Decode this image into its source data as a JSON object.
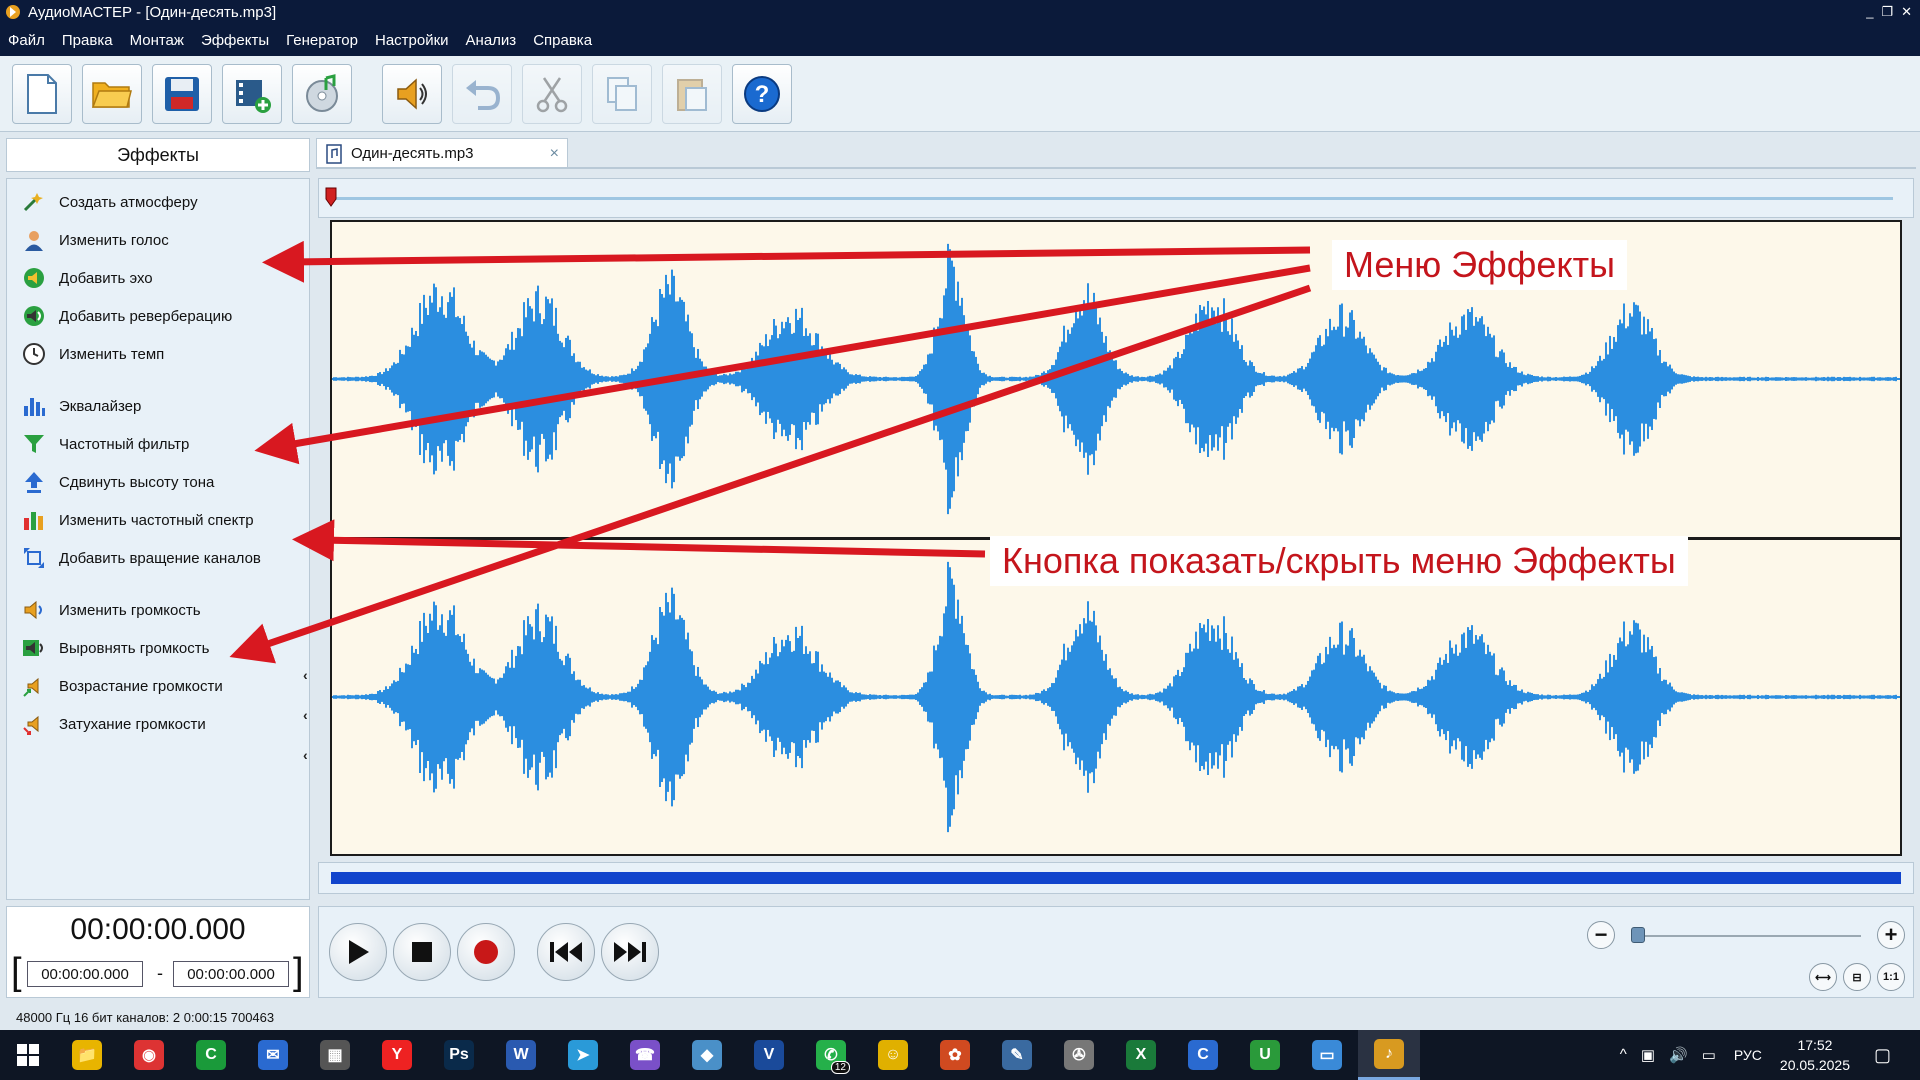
{
  "window": {
    "title": "АудиоМАСТЕР - [Один-десять.mp3]",
    "controls": [
      "_",
      "❐",
      "✕"
    ]
  },
  "menubar": {
    "items": [
      "Файл",
      "Правка",
      "Монтаж",
      "Эффекты",
      "Генератор",
      "Настройки",
      "Анализ",
      "Справка"
    ]
  },
  "toolbar": {
    "buttons": [
      "new-file-icon",
      "open-folder-icon",
      "save-disk-icon",
      "video-add-icon",
      "cd-music-icon",
      "speaker-effects-icon",
      "undo-icon",
      "cut-scissors-icon",
      "copy-icon",
      "paste-icon",
      "help-icon"
    ]
  },
  "effects_panel": {
    "header": "Эффекты",
    "items": [
      "Создать атмосферу",
      "Изменить голос",
      "Добавить эхо",
      "Добавить реверберацию",
      "Изменить темп",
      "Эквалайзер",
      "Частотный фильтр",
      "Сдвинуть высоту тона",
      "Изменить частотный спектр",
      "Добавить вращение каналов",
      "Изменить громкость",
      "Выровнять громкость",
      "Возрастание громкости",
      "Затухание громкости"
    ],
    "collapse_glyph": "‹"
  },
  "tab": {
    "label": "Один-десять.mp3",
    "close": "×"
  },
  "time": {
    "current": "00:00:00.000",
    "selection_start": "00:00:00.000",
    "selection_end": "00:00:00.000",
    "bracket_left": "[",
    "bracket_right": "]",
    "dash": "-"
  },
  "zoom": {
    "minus": "−",
    "plus": "+",
    "level": 0.0,
    "fit_labels": [
      "⟷",
      "⊟",
      "1:1"
    ]
  },
  "status": {
    "text": "48000 Гц  16 бит  каналов: 2   0:00:15 700463"
  },
  "annotations": {
    "effects_menu": "Меню Эффекты",
    "toggle_button": "Кнопка показать/скрыть меню Эффекты"
  },
  "taskbar": {
    "apps": [
      {
        "name": "file-explorer",
        "glyph": "📁",
        "color": "#e8b400"
      },
      {
        "name": "chrome",
        "glyph": "◉",
        "color": "#d33"
      },
      {
        "name": "green-app",
        "glyph": "C",
        "color": "#1a9a3a"
      },
      {
        "name": "outlook",
        "glyph": "✉",
        "color": "#2a6ad0"
      },
      {
        "name": "calculator",
        "glyph": "▦",
        "color": "#555"
      },
      {
        "name": "yandex",
        "glyph": "Y",
        "color": "#e22"
      },
      {
        "name": "photoshop",
        "glyph": "Ps",
        "color": "#0a2a4a"
      },
      {
        "name": "word",
        "glyph": "W",
        "color": "#2a5ab0"
      },
      {
        "name": "telegram",
        "glyph": "➤",
        "color": "#2a9ad8"
      },
      {
        "name": "viber",
        "glyph": "☎",
        "color": "#7a50c8"
      },
      {
        "name": "notes",
        "glyph": "◆",
        "color": "#4a90c8"
      },
      {
        "name": "v-app",
        "glyph": "V",
        "color": "#1a4a9a"
      },
      {
        "name": "whatsapp",
        "glyph": "✆",
        "color": "#25b04a",
        "badge": "12"
      },
      {
        "name": "emoji-app",
        "glyph": "☺",
        "color": "#e0b000"
      },
      {
        "name": "color-wheel",
        "glyph": "✿",
        "color": "#d04a20"
      },
      {
        "name": "feather-app",
        "glyph": "✎",
        "color": "#3a6aa0"
      },
      {
        "name": "film-reel",
        "glyph": "✇",
        "color": "#777"
      },
      {
        "name": "excel",
        "glyph": "X",
        "color": "#1a7a3a"
      },
      {
        "name": "c-app",
        "glyph": "C",
        "color": "#2a6ad0"
      },
      {
        "name": "u-app",
        "glyph": "U",
        "color": "#2a9a3a"
      },
      {
        "name": "monitor",
        "glyph": "▭",
        "color": "#3a8ad8"
      },
      {
        "name": "audiomaster",
        "glyph": "♪",
        "color": "#d89a20"
      }
    ],
    "tray": {
      "icons": [
        "^",
        "▣",
        "🔊",
        "▭"
      ],
      "lang": "РУС",
      "time": "17:52",
      "date": "20.05.2025",
      "notif": "▢"
    }
  },
  "colors": {
    "waveform": "#2b8ee0",
    "wave_bg": "#fdf8ea",
    "annotation_red": "#c4151c",
    "titlebar": "#0b1a3a",
    "scroll_bar": "#1144cc"
  }
}
